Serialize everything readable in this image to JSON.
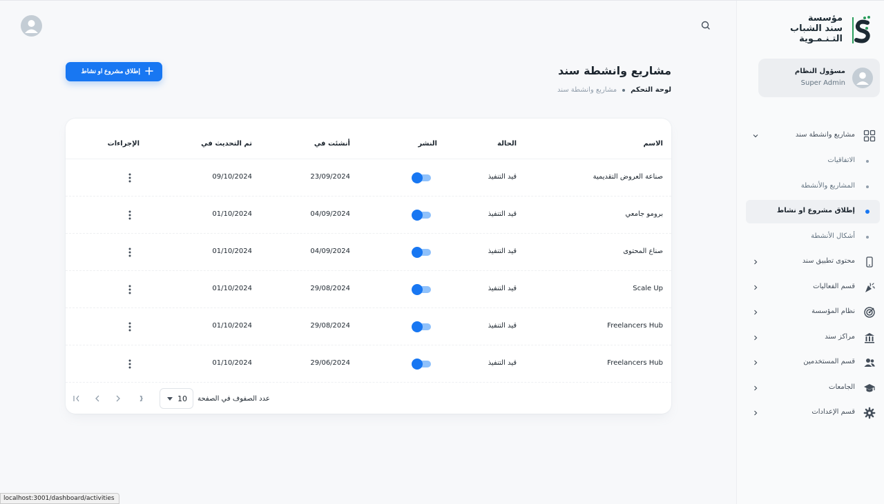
{
  "brand": {
    "line1": "مؤسسة",
    "line2": "سند الشباب",
    "line3": "التـنـمـوية"
  },
  "user": {
    "name": "مسؤول النظام",
    "role": "Super Admin"
  },
  "nav": {
    "projects": "مشاريع وانشطة سند",
    "sub": [
      {
        "label": "الاتفاقيات"
      },
      {
        "label": "المشاريع والأنشطة"
      },
      {
        "label": "إطلاق مشروع او نشاط"
      },
      {
        "label": "أشكال الأنشطة"
      }
    ],
    "items": [
      {
        "label": "محتوى تطبيق سند",
        "icon": "phone-icon"
      },
      {
        "label": "قسم الفعاليات",
        "icon": "party-icon"
      },
      {
        "label": "نظام المؤسسة",
        "icon": "target-icon"
      },
      {
        "label": "مراكز سند",
        "icon": "bank-icon"
      },
      {
        "label": "قسم المستخدمين",
        "icon": "users-icon"
      },
      {
        "label": "الجامعات",
        "icon": "graduation-cap-icon"
      },
      {
        "label": "قسم الإعدادات",
        "icon": "gear-icon"
      }
    ]
  },
  "page": {
    "title": "مشاريع وانشطة سند",
    "crumb_home": "لوحة التحكم",
    "crumb_current": "مشاريع وانشطة سند",
    "launch_label": "إطلاق مشروع او نشاط"
  },
  "table": {
    "headers": {
      "name": "الاسم",
      "status": "الحالة",
      "publish": "النشر",
      "created": "أنشئت في",
      "updated": "تم التحديث في",
      "actions": "الإجراءات"
    },
    "rows": [
      {
        "name": "صناعة العروض التقديمية",
        "status": "قيد التنفيذ",
        "published": true,
        "created": "23/09/2024",
        "updated": "09/10/2024"
      },
      {
        "name": "برومو جامعي",
        "status": "قيد التنفيذ",
        "published": true,
        "created": "04/09/2024",
        "updated": "01/10/2024"
      },
      {
        "name": "صناع المحتوى",
        "status": "قيد التنفيذ",
        "published": true,
        "created": "04/09/2024",
        "updated": "01/10/2024"
      },
      {
        "name": "Scale Up",
        "status": "قيد التنفيذ",
        "published": true,
        "created": "29/08/2024",
        "updated": "01/10/2024"
      },
      {
        "name": "Freelancers Hub",
        "status": "قيد التنفيذ",
        "published": true,
        "created": "29/08/2024",
        "updated": "01/10/2024"
      },
      {
        "name": "Freelancers Hub",
        "status": "قيد التنفيذ",
        "published": true,
        "created": "29/06/2024",
        "updated": "01/10/2024"
      }
    ],
    "rows_per_page_label": "عدد الصفوف في الصفحة",
    "rows_per_page": "10"
  },
  "status_bar": {
    "url": "localhost:3001/dashboard/activities"
  },
  "colors": {
    "primary": "#1877f2",
    "primary_light": "#8fc1fb",
    "text": "#1c252e",
    "muted": "#637381"
  }
}
